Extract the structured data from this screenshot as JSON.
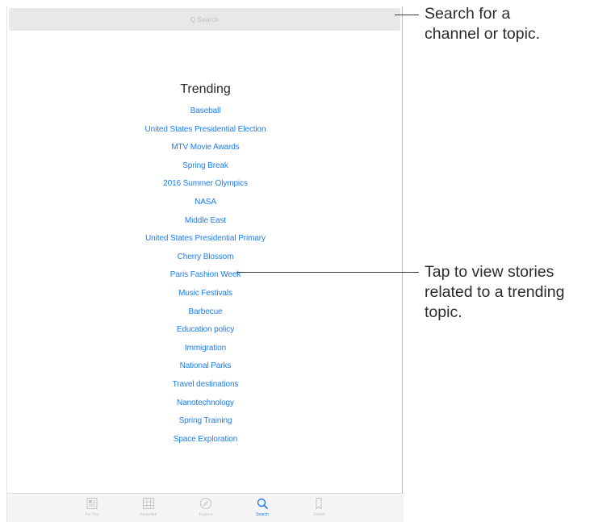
{
  "search": {
    "placeholder": "Q Search"
  },
  "trending": {
    "title": "Trending",
    "topics": [
      "Baseball",
      "United States Presidential Election",
      "MTV Movie Awards",
      "Spring Break",
      "2016 Summer Olympics",
      "NASA",
      "Middle East",
      "United States Presidential Primary",
      "Cherry Blossom",
      "Paris Fashion Week",
      "Music Festivals",
      "Barbecue",
      "Education policy",
      "Immigration",
      "National Parks",
      "Travel destinations",
      "Nanotechnology",
      "Spring Training",
      "Space Exploration"
    ]
  },
  "tab_bar": {
    "tabs": [
      {
        "label": "For You",
        "icon": "newspaper-icon",
        "active": false
      },
      {
        "label": "Favorites",
        "icon": "grid-icon",
        "active": false
      },
      {
        "label": "Explore",
        "icon": "compass-icon",
        "active": false
      },
      {
        "label": "Search",
        "icon": "search-icon",
        "active": true
      },
      {
        "label": "Saved",
        "icon": "bookmark-icon",
        "active": false
      }
    ]
  },
  "callouts": {
    "search": "Search for a\nchannel or topic.",
    "trending": "Tap to view stories\nrelated to a trending\ntopic."
  },
  "colors": {
    "link": "#1a7cf0",
    "tab_inactive": "#c2c2c2",
    "search_bar": "#e8e8e8"
  }
}
